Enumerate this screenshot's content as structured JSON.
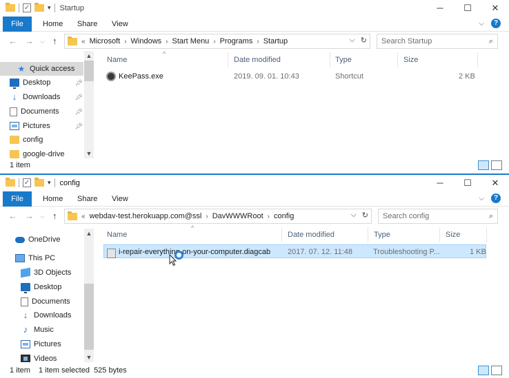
{
  "top_window": {
    "title": "Startup",
    "ribbon_tabs": [
      "File",
      "Home",
      "Share",
      "View"
    ],
    "breadcrumb": [
      "Microsoft",
      "Windows",
      "Start Menu",
      "Programs",
      "Startup"
    ],
    "breadcrumb_prefix": "«",
    "search_placeholder": "Search Startup",
    "sidebar": [
      {
        "label": "Quick access",
        "icon": "star-icon",
        "pinned": false,
        "selected": true
      },
      {
        "label": "Desktop",
        "icon": "desktop-icon",
        "pinned": true
      },
      {
        "label": "Downloads",
        "icon": "download-icon",
        "pinned": true
      },
      {
        "label": "Documents",
        "icon": "document-icon",
        "pinned": true
      },
      {
        "label": "Pictures",
        "icon": "pictures-icon",
        "pinned": true
      },
      {
        "label": "config",
        "icon": "folder-icon",
        "pinned": false
      },
      {
        "label": "google-drive",
        "icon": "folder-icon",
        "pinned": false
      }
    ],
    "columns": [
      "Name",
      "Date modified",
      "Type",
      "Size"
    ],
    "files": [
      {
        "name": "KeePass.exe",
        "date": "2019. 09. 01. 10:43",
        "type": "Shortcut",
        "size": "2 KB",
        "icon": "keepass-icon"
      }
    ],
    "status": "1 item"
  },
  "bottom_window": {
    "title": "config",
    "ribbon_tabs": [
      "File",
      "Home",
      "Share",
      "View"
    ],
    "breadcrumb": [
      "webdav-test.herokuapp.com@ssl",
      "DavWWWRoot",
      "config"
    ],
    "breadcrumb_prefix": "«",
    "search_placeholder": "Search config",
    "sidebar": [
      {
        "label": "OneDrive",
        "icon": "onedrive-icon"
      },
      {
        "label": "This PC",
        "icon": "this-pc-icon"
      },
      {
        "label": "3D Objects",
        "icon": "3d-objects-icon"
      },
      {
        "label": "Desktop",
        "icon": "desktop-icon"
      },
      {
        "label": "Documents",
        "icon": "document-icon"
      },
      {
        "label": "Downloads",
        "icon": "download-icon"
      },
      {
        "label": "Music",
        "icon": "music-icon"
      },
      {
        "label": "Pictures",
        "icon": "pictures-icon"
      },
      {
        "label": "Videos",
        "icon": "videos-icon"
      }
    ],
    "columns": [
      "Name",
      "Date modified",
      "Type",
      "Size"
    ],
    "files": [
      {
        "name": "i-repair-everything-on-your-computer.diagcab",
        "date": "2017. 07. 12. 11:48",
        "type": "Troubleshooting P...",
        "size": "1 KB",
        "icon": "diagcab-icon",
        "selected": true
      }
    ],
    "status_count": "1 item",
    "status_selected": "1 item selected  525 bytes"
  },
  "colors": {
    "accent": "#1979ca",
    "selection": "#cce8ff",
    "folder": "#f6c552"
  }
}
